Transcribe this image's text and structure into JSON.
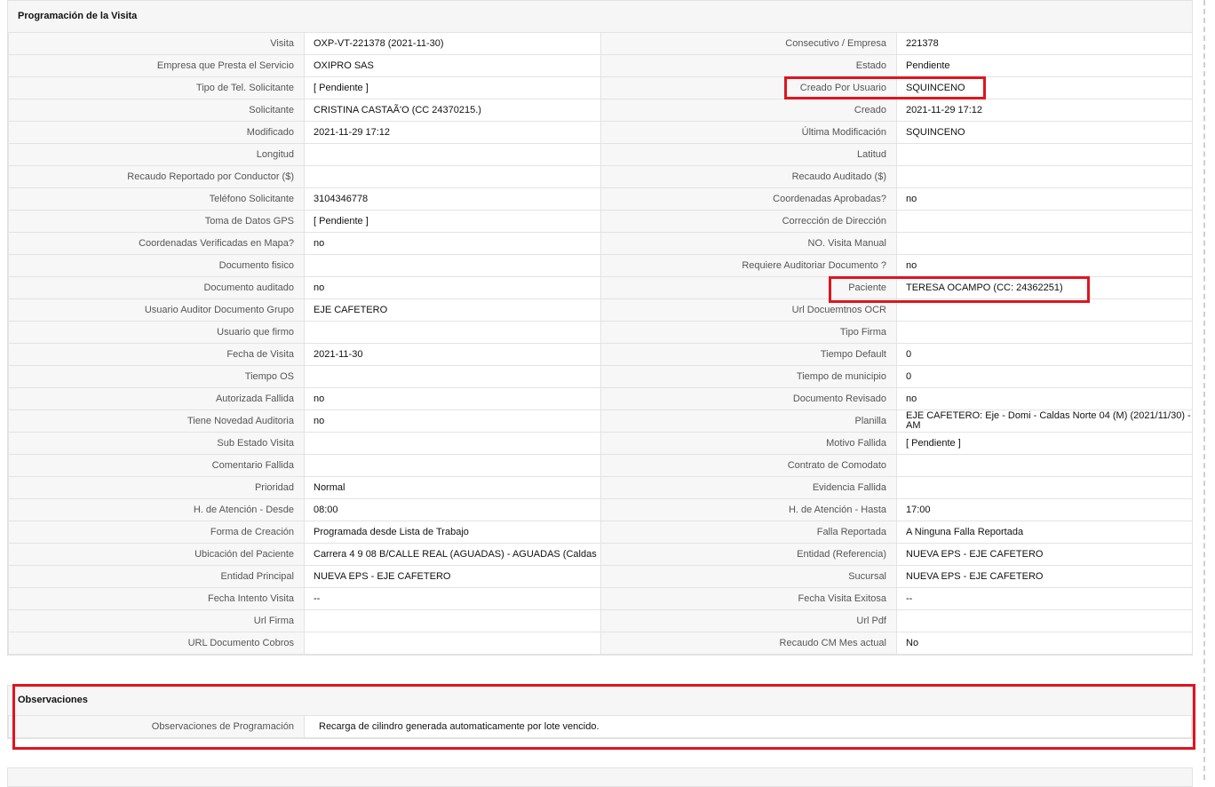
{
  "programacion": {
    "title": "Programación de la Visita",
    "rows": [
      {
        "l1": "Visita",
        "v1": "OXP-VT-221378 (2021-11-30)",
        "l2": "Consecutivo / Empresa",
        "v2": "221378"
      },
      {
        "l1": "Empresa que Presta el Servicio",
        "v1": "OXIPRO SAS",
        "l2": "Estado",
        "v2": "Pendiente"
      },
      {
        "l1": "Tipo de Tel. Solicitante",
        "v1": "[ Pendiente ]",
        "l2": "Creado Por Usuario",
        "v2": "SQUINCENO"
      },
      {
        "l1": "Solicitante",
        "v1": "CRISTINA CASTAÃ'O (CC 24370215.)",
        "l2": "Creado",
        "v2": "2021-11-29 17:12"
      },
      {
        "l1": "Modificado",
        "v1": "2021-11-29 17:12",
        "l2": "Última Modificación",
        "v2": " SQUINCENO"
      },
      {
        "l1": "Longitud",
        "v1": "",
        "l2": "Latitud",
        "v2": ""
      },
      {
        "l1": "Recaudo Reportado por Conductor ($)",
        "v1": "",
        "l2": "Recaudo Auditado ($)",
        "v2": ""
      },
      {
        "l1": "Teléfono Solicitante",
        "v1": "3104346778",
        "l2": "Coordenadas Aprobadas?",
        "v2": " no"
      },
      {
        "l1": "Toma de Datos GPS",
        "v1": "[ Pendiente ]",
        "l2": "Corrección de Dirección",
        "v2": ""
      },
      {
        "l1": "Coordenadas Verificadas en Mapa?",
        "v1": " no",
        "l2": "NO. Visita Manual",
        "v2": ""
      },
      {
        "l1": "Documento fisico",
        "v1": "",
        "l2": "Requiere Auditoriar Documento ?",
        "v2": " no"
      },
      {
        "l1": "Documento auditado",
        "v1": " no",
        "l2": "Paciente",
        "v2": "TERESA OCAMPO (CC: 24362251)"
      },
      {
        "l1": "Usuario Auditor Documento Grupo",
        "v1": "EJE CAFETERO",
        "l2": "Url Docuemtnos OCR",
        "v2": ""
      },
      {
        "l1": "Usuario que firmo",
        "v1": "",
        "l2": "Tipo Firma",
        "v2": ""
      },
      {
        "l1": "Fecha de Visita",
        "v1": " 2021-11-30",
        "l2": "Tiempo Default",
        "v2": "0"
      },
      {
        "l1": "Tiempo OS",
        "v1": "",
        "l2": "Tiempo de municipio",
        "v2": "0"
      },
      {
        "l1": "Autorizada Fallida",
        "v1": " no",
        "l2": "Documento Revisado",
        "v2": " no"
      },
      {
        "l1": "Tiene Novedad Auditoria",
        "v1": " no",
        "l2": "Planilla",
        "v2": "EJE CAFETERO: Eje - Domi - Caldas Norte 04 (M) (2021/11/30) - AM"
      },
      {
        "l1": "Sub Estado Visita",
        "v1": "",
        "l2": "Motivo Fallida",
        "v2": "[ Pendiente ]"
      },
      {
        "l1": "Comentario Fallida",
        "v1": "",
        "l2": "Contrato de Comodato",
        "v2": ""
      },
      {
        "l1": "Prioridad",
        "v1": "Normal",
        "l2": "Evidencia Fallida",
        "v2": ""
      },
      {
        "l1": "H. de Atención - Desde",
        "v1": "08:00",
        "l2": "H. de Atención - Hasta",
        "v2": "17:00"
      },
      {
        "l1": "Forma de Creación",
        "v1": "Programada desde Lista de Trabajo",
        "l2": "Falla Reportada",
        "v2": "A Ninguna Falla Reportada"
      },
      {
        "l1": "Ubicación del Paciente",
        "v1": "Carrera 4 9 08 B/CALLE REAL (AGUADAS) - AGUADAS (Caldas",
        "l2": "Entidad (Referencia)",
        "v2": "NUEVA EPS - EJE CAFETERO"
      },
      {
        "l1": "Entidad Principal",
        "v1": "NUEVA EPS - EJE CAFETERO",
        "l2": "Sucursal",
        "v2": "NUEVA EPS - EJE CAFETERO"
      },
      {
        "l1": "Fecha Intento Visita",
        "v1": " --",
        "l2": "Fecha Visita Exitosa",
        "v2": " --"
      },
      {
        "l1": "Url Firma",
        "v1": "",
        "l2": "Url Pdf",
        "v2": ""
      },
      {
        "l1": "URL Documento Cobros",
        "v1": "",
        "l2": "Recaudo CM Mes actual",
        "v2": "No"
      }
    ]
  },
  "observaciones": {
    "title": "Observaciones",
    "label": "Observaciones de Programación",
    "value": "Recarga de cilindro generada automaticamente por lote vencido."
  },
  "colors": {
    "highlight": "#e0141e",
    "label_bg": "#f7f7f7",
    "border": "#e3e3e3"
  }
}
